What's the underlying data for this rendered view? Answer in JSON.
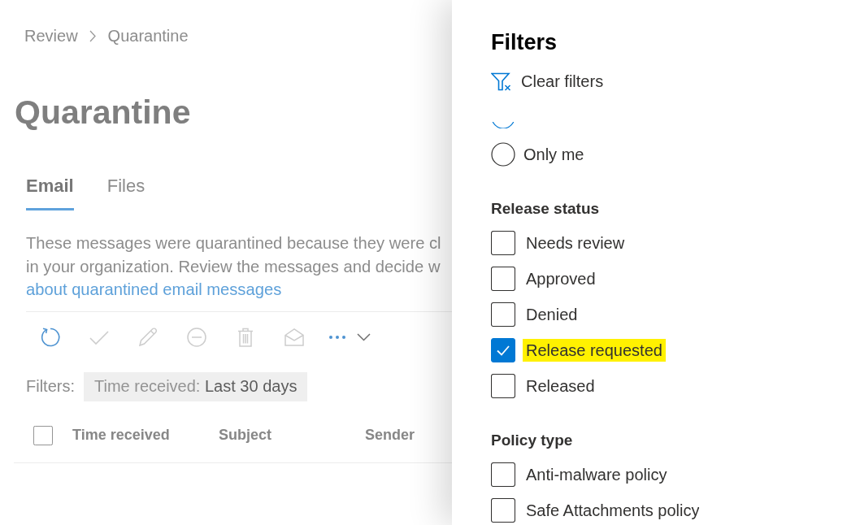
{
  "breadcrumb": [
    "Review",
    "Quarantine"
  ],
  "page_title": "Quarantine",
  "tabs": [
    {
      "label": "Email",
      "selected": true
    },
    {
      "label": "Files",
      "selected": false
    }
  ],
  "description": {
    "lines": [
      "These messages were quarantined because they were cl",
      "in your organization. Review the messages and decide w"
    ],
    "link": "about quarantined email messages"
  },
  "toolbar": [
    {
      "kind": "refresh",
      "disabled": false
    },
    {
      "kind": "approve",
      "disabled": true
    },
    {
      "kind": "edit",
      "disabled": true
    },
    {
      "kind": "deny",
      "disabled": true
    },
    {
      "kind": "delete",
      "disabled": true
    },
    {
      "kind": "read",
      "disabled": true
    },
    {
      "kind": "more",
      "disabled": false
    }
  ],
  "filters_bar": {
    "label": "Filters:",
    "chips": [
      {
        "name": "Time received:",
        "value": "Last 30 days"
      }
    ]
  },
  "table": {
    "select_all": {
      "checked": false
    },
    "columns": [
      "Time received",
      "Subject",
      "Sender"
    ]
  },
  "filters_panel": {
    "title": "Filters",
    "clear_button": "Clear filters",
    "sections": [
      {
        "kind": "radio",
        "options": [
          {
            "selected": true
          },
          {
            "label": "Only me",
            "selected": false
          }
        ]
      },
      {
        "kind": "checkbox",
        "heading": "Release status",
        "options": [
          {
            "label": "Needs review",
            "checked": false,
            "highlighted": false
          },
          {
            "label": "Approved",
            "checked": false,
            "highlighted": false
          },
          {
            "label": "Denied",
            "checked": false,
            "highlighted": false
          },
          {
            "label": "Release requested",
            "checked": true,
            "highlighted": true
          },
          {
            "label": "Released",
            "checked": false,
            "highlighted": false
          }
        ]
      },
      {
        "kind": "checkbox",
        "heading": "Policy type",
        "options": [
          {
            "label": "Anti-malware policy",
            "checked": false,
            "highlighted": false
          },
          {
            "label": "Safe Attachments policy",
            "checked": false,
            "highlighted": false
          }
        ]
      }
    ]
  }
}
